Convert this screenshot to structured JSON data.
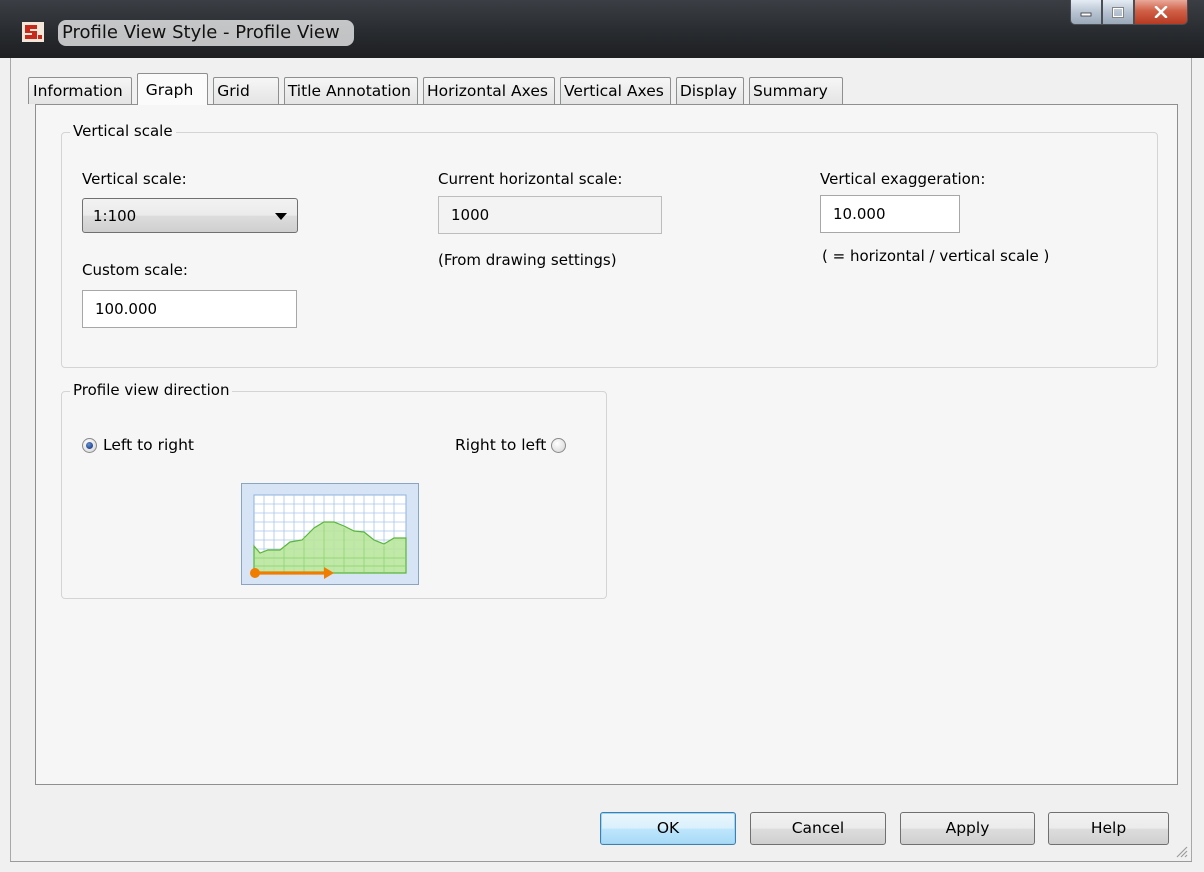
{
  "window": {
    "title": "Profile View Style - Profile View"
  },
  "tabs": [
    {
      "label": "Information",
      "active": false
    },
    {
      "label": "Graph",
      "active": true
    },
    {
      "label": "Grid",
      "active": false
    },
    {
      "label": "Title Annotation",
      "active": false
    },
    {
      "label": "Horizontal Axes",
      "active": false
    },
    {
      "label": "Vertical Axes",
      "active": false
    },
    {
      "label": "Display",
      "active": false
    },
    {
      "label": "Summary",
      "active": false
    }
  ],
  "vertical_scale_group": {
    "title": "Vertical scale",
    "vertical_scale_label": "Vertical scale:",
    "vertical_scale_value": "1:100",
    "custom_scale_label": "Custom scale:",
    "custom_scale_value": "100.000",
    "current_horizontal_scale_label": "Current horizontal scale:",
    "current_horizontal_scale_value": "1000",
    "from_drawing_settings": "(From drawing settings)",
    "vertical_exaggeration_label": "Vertical exaggeration:",
    "vertical_exaggeration_value": "10.000",
    "exaggeration_note": "( = horizontal / vertical scale )"
  },
  "direction_group": {
    "title": "Profile view direction",
    "left_to_right_label": "Left to right",
    "left_to_right_checked": true,
    "right_to_left_label": "Right to left",
    "right_to_left_checked": false,
    "preview_icon": "profile-direction-preview-icon"
  },
  "buttons": {
    "ok": "OK",
    "cancel": "Cancel",
    "apply": "Apply",
    "help": "Help"
  },
  "colors": {
    "accent_blue": "#3c7fb1",
    "profile_fill": "#b9e59c",
    "profile_line": "#59b63a",
    "arrow_orange": "#f07d00"
  }
}
